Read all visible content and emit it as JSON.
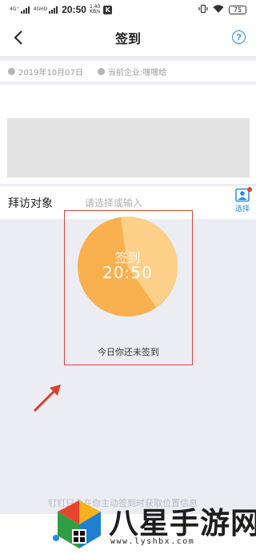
{
  "status_bar": {
    "signal1": "4G⁺",
    "signal2": "4GHD",
    "time": "20:50",
    "speed_value": "1.40",
    "speed_unit": "KB/s",
    "app_icon": "K",
    "battery": "75"
  },
  "nav": {
    "title": "签到",
    "help_icon": "?"
  },
  "info": {
    "date": "2019年10月07日",
    "company": "当前企业:嘿嘿给"
  },
  "visit": {
    "label": "拜访对象",
    "placeholder": "请选择或输入",
    "select_label": "选择"
  },
  "sign": {
    "label": "签到",
    "time": "20:50",
    "status": "今日你还未签到"
  },
  "bottom": {
    "hint": "钉钉只会在你主动签到时获取位置信息"
  },
  "watermark": {
    "title": "八星手游网",
    "url": "www.lyshbx.com"
  },
  "colors": {
    "accent": "#2a8ae0",
    "sign_orange": "#f9b04e",
    "sign_light": "#fdd08a",
    "highlight": "#d2483c"
  }
}
